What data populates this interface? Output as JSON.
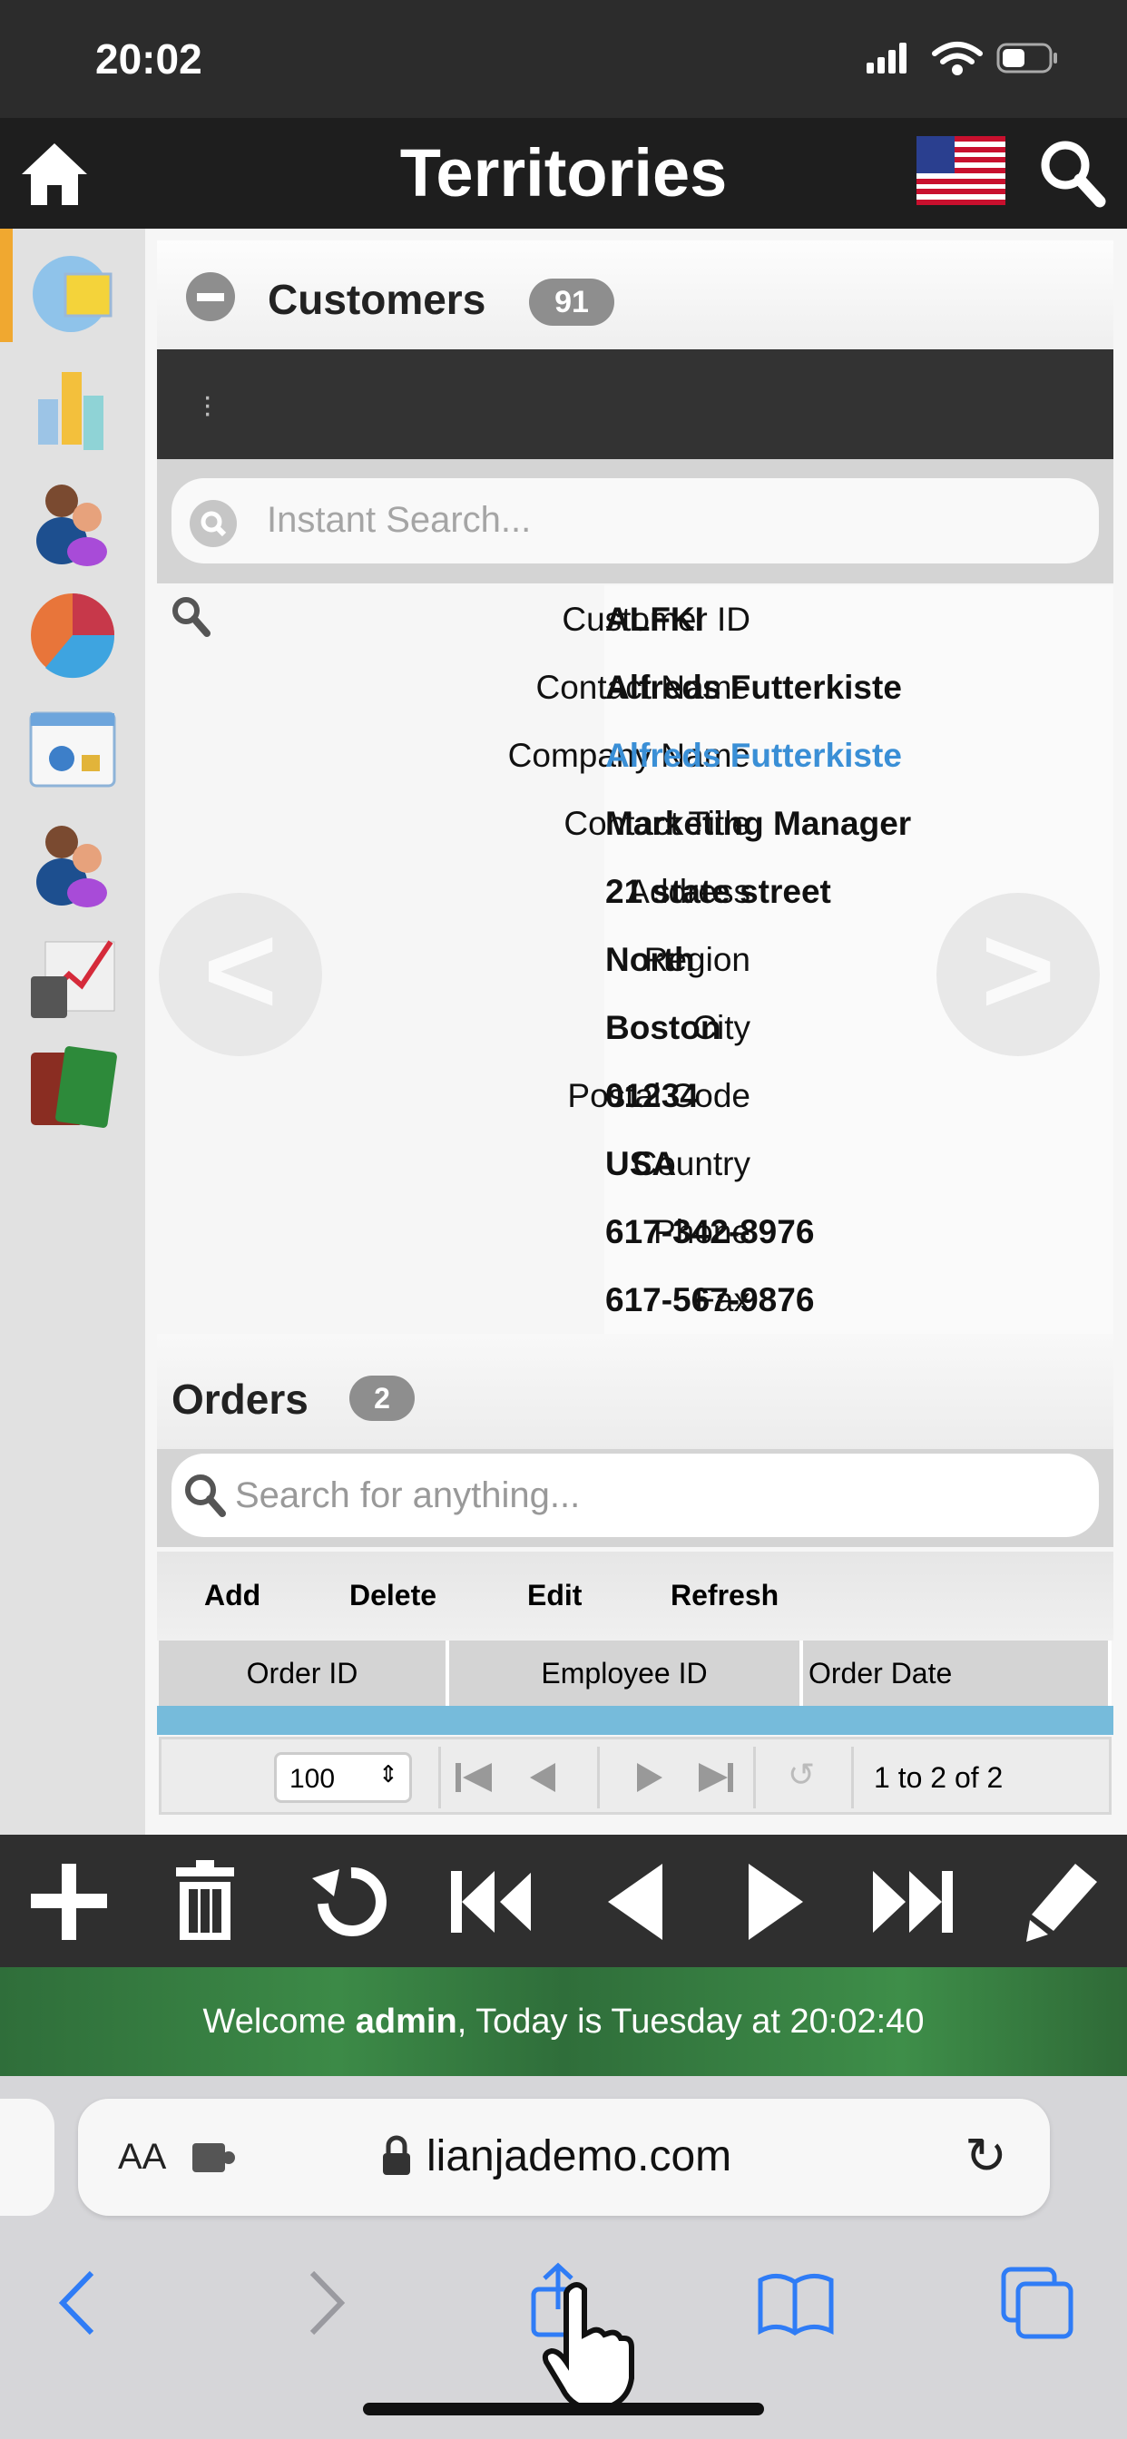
{
  "status_bar": {
    "time": "20:02"
  },
  "header": {
    "title": "Territories",
    "home_icon": "home-icon",
    "flag_icon": "us-flag-icon",
    "search_icon": "search-icon"
  },
  "sidebar": {
    "items": [
      "globe-monitor-icon",
      "bar-chart-icon",
      "users-icon",
      "pie-chart-icon",
      "web-security-icon",
      "users-icon",
      "calculator-chart-icon",
      "passport-icon"
    ],
    "active_color": "#f0a830"
  },
  "customers": {
    "title": "Customers",
    "count": "91",
    "search_placeholder": "Instant Search...",
    "fields": [
      {
        "label": "Customer ID",
        "value": "ALFKI"
      },
      {
        "label": "Contact Name",
        "value": "Alfreds Futterkiste"
      },
      {
        "label": "Company Name",
        "value": "Alfreds Futterkiste",
        "link": true
      },
      {
        "label": "Contact Title",
        "value": "Marketing Manager"
      },
      {
        "label": "Address",
        "value": "21 state street"
      },
      {
        "label": "Region",
        "value": "North"
      },
      {
        "label": "City",
        "value": "Boston"
      },
      {
        "label": "Postal Code",
        "value": "01234"
      },
      {
        "label": "Country",
        "value": "USA"
      },
      {
        "label": "Phone",
        "value": "617-342-8976"
      },
      {
        "label": "Fax",
        "value": "617-567-9876"
      }
    ],
    "prev_label": "<",
    "next_label": ">",
    "link_color": "#3a8fd6"
  },
  "orders": {
    "title": "Orders",
    "count": "2",
    "search_placeholder": "Search for anything...",
    "toolbar": {
      "add": "Add",
      "delete": "Delete",
      "edit": "Edit",
      "refresh": "Refresh"
    },
    "columns": [
      "Order ID",
      "Employee ID",
      "Order Date"
    ],
    "pager": {
      "page_size": "100",
      "summary": "1 to 2 of 2"
    }
  },
  "bottom_toolbar": [
    "add-icon",
    "delete-icon",
    "refresh-icon",
    "first-icon",
    "previous-icon",
    "next-icon",
    "last-icon",
    "edit-icon"
  ],
  "welcome": {
    "prefix": "Welcome ",
    "user": "admin",
    "suffix": ", Today is Tuesday at 20:02:40"
  },
  "browser": {
    "aa": "AA",
    "url": "lianjademo.com"
  }
}
